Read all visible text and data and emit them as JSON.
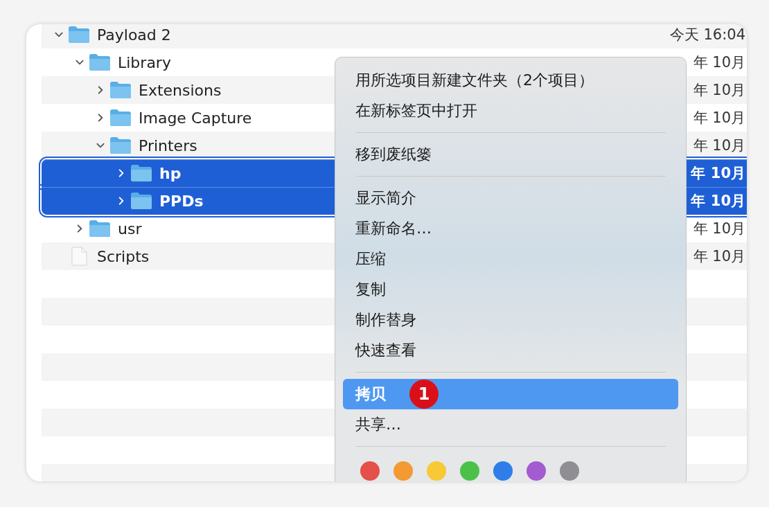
{
  "tree": [
    {
      "name": "Payload 2",
      "kind": "folder",
      "expanded": true,
      "selected": false,
      "date": "今天 16:04",
      "children": [
        {
          "name": "Library",
          "kind": "folder",
          "expanded": true,
          "selected": false,
          "date": "年 10月",
          "children": [
            {
              "name": "Extensions",
              "kind": "folder",
              "expanded": false,
              "selected": false,
              "date": "年 10月"
            },
            {
              "name": "Image Capture",
              "kind": "folder",
              "expanded": false,
              "selected": false,
              "date": "年 10月"
            },
            {
              "name": "Printers",
              "kind": "folder",
              "expanded": true,
              "selected": false,
              "date": "年 10月",
              "children": [
                {
                  "name": "hp",
                  "kind": "folder",
                  "expanded": false,
                  "selected": true,
                  "date": "年 10月"
                },
                {
                  "name": "PPDs",
                  "kind": "folder",
                  "expanded": false,
                  "selected": true,
                  "date": "年 10月"
                }
              ]
            }
          ]
        },
        {
          "name": "usr",
          "kind": "folder",
          "expanded": false,
          "selected": false,
          "date": "年 10月"
        }
      ]
    },
    {
      "name": "Scripts",
      "kind": "file",
      "selected": false,
      "date": "年 10月"
    }
  ],
  "menu": {
    "groups": [
      {
        "items": [
          {
            "label": "用所选项目新建文件夹（2个项目）",
            "selected": false
          },
          {
            "label": "在新标签页中打开",
            "selected": false
          }
        ]
      },
      {
        "items": [
          {
            "label": "移到废纸篓",
            "selected": false
          }
        ]
      },
      {
        "items": [
          {
            "label": "显示简介",
            "selected": false
          },
          {
            "label": "重新命名…",
            "selected": false
          },
          {
            "label": "压缩",
            "selected": false
          },
          {
            "label": "复制",
            "selected": false
          },
          {
            "label": "制作替身",
            "selected": false
          },
          {
            "label": "快速查看",
            "selected": false
          }
        ]
      },
      {
        "items": [
          {
            "label": "拷贝",
            "selected": true,
            "badge": "1"
          },
          {
            "label": "共享…",
            "selected": false
          }
        ]
      }
    ],
    "tags": [
      {
        "color": "#e5504a"
      },
      {
        "color": "#f39a32"
      },
      {
        "color": "#f7c935"
      },
      {
        "color": "#4cc14a"
      },
      {
        "color": "#2f7de8"
      },
      {
        "color": "#a35bd0"
      },
      {
        "color": "#8e8e93"
      }
    ]
  }
}
